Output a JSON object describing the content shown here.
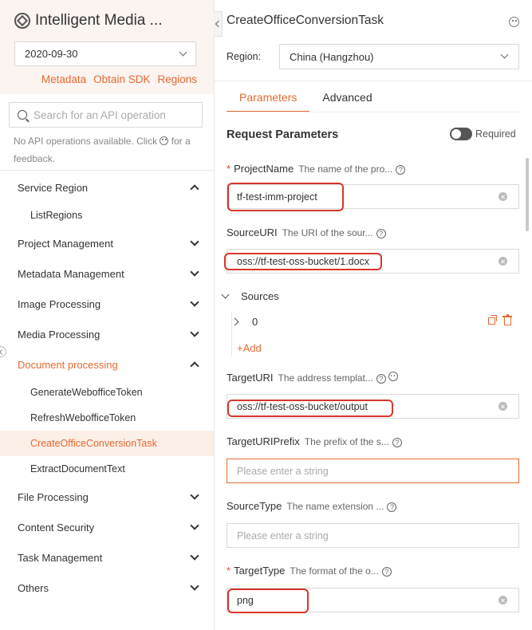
{
  "sidebar": {
    "app_title": "Intelligent Media ...",
    "version": "2020-09-30",
    "links": [
      "Metadata",
      "Obtain SDK",
      "Regions"
    ],
    "search_placeholder": "Search for an API operation",
    "no_api_text": "No API operations available. Click",
    "no_api_text_2": "for a feedback.",
    "items": [
      {
        "label": "Service Region",
        "type": "group",
        "state": "expanded"
      },
      {
        "label": "ListRegions",
        "type": "sub"
      },
      {
        "label": "Project Management",
        "type": "group",
        "state": "collapsed"
      },
      {
        "label": "Metadata Management",
        "type": "group",
        "state": "collapsed"
      },
      {
        "label": "Image Processing",
        "type": "group",
        "state": "collapsed"
      },
      {
        "label": "Media Processing",
        "type": "group",
        "state": "collapsed"
      },
      {
        "label": "Document processing",
        "type": "group",
        "state": "expanded"
      },
      {
        "label": "GenerateWebofficeToken",
        "type": "sub"
      },
      {
        "label": "RefreshWebofficeToken",
        "type": "sub"
      },
      {
        "label": "CreateOfficeConversionTask",
        "type": "sub",
        "state": "active"
      },
      {
        "label": "ExtractDocumentText",
        "type": "sub"
      },
      {
        "label": "File Processing",
        "type": "group",
        "state": "collapsed"
      },
      {
        "label": "Content Security",
        "type": "group",
        "state": "collapsed"
      },
      {
        "label": "Task Management",
        "type": "group",
        "state": "collapsed"
      },
      {
        "label": "Others",
        "type": "group",
        "state": "collapsed"
      }
    ]
  },
  "main": {
    "api_title": "CreateOfficeConversionTask",
    "region_label": "Region:",
    "region_value": "China (Hangzhou)",
    "tabs": [
      {
        "label": "Parameters",
        "active": true
      },
      {
        "label": "Advanced",
        "active": false
      }
    ],
    "request_title": "Request Parameters",
    "required_toggle_label": "Required",
    "fields": {
      "project_name": {
        "label": "ProjectName",
        "desc": "The name of the pro...",
        "value": "tf-test-imm-project",
        "required": true
      },
      "source_uri": {
        "label": "SourceURI",
        "desc": "The URI of the sour...",
        "value": "oss://tf-test-oss-bucket/1.docx"
      },
      "sources": {
        "label": "Sources",
        "item_index": "0",
        "add_label": "+Add"
      },
      "target_uri": {
        "label": "TargetURI",
        "desc": "The address templat...",
        "value": "oss://tf-test-oss-bucket/output"
      },
      "target_uri_prefix": {
        "label": "TargetURIPrefix",
        "desc": "The prefix of the s...",
        "placeholder": "Please enter a string"
      },
      "source_type": {
        "label": "SourceType",
        "desc": "The name extension ...",
        "placeholder": "Please enter a string"
      },
      "target_type": {
        "label": "TargetType",
        "desc": "The format of the o...",
        "value": "png",
        "required": true
      }
    }
  },
  "colors": {
    "accent": "#e46a32",
    "highlight": "#d8342a",
    "sidebar_head_bg": "#fbf4f1"
  }
}
